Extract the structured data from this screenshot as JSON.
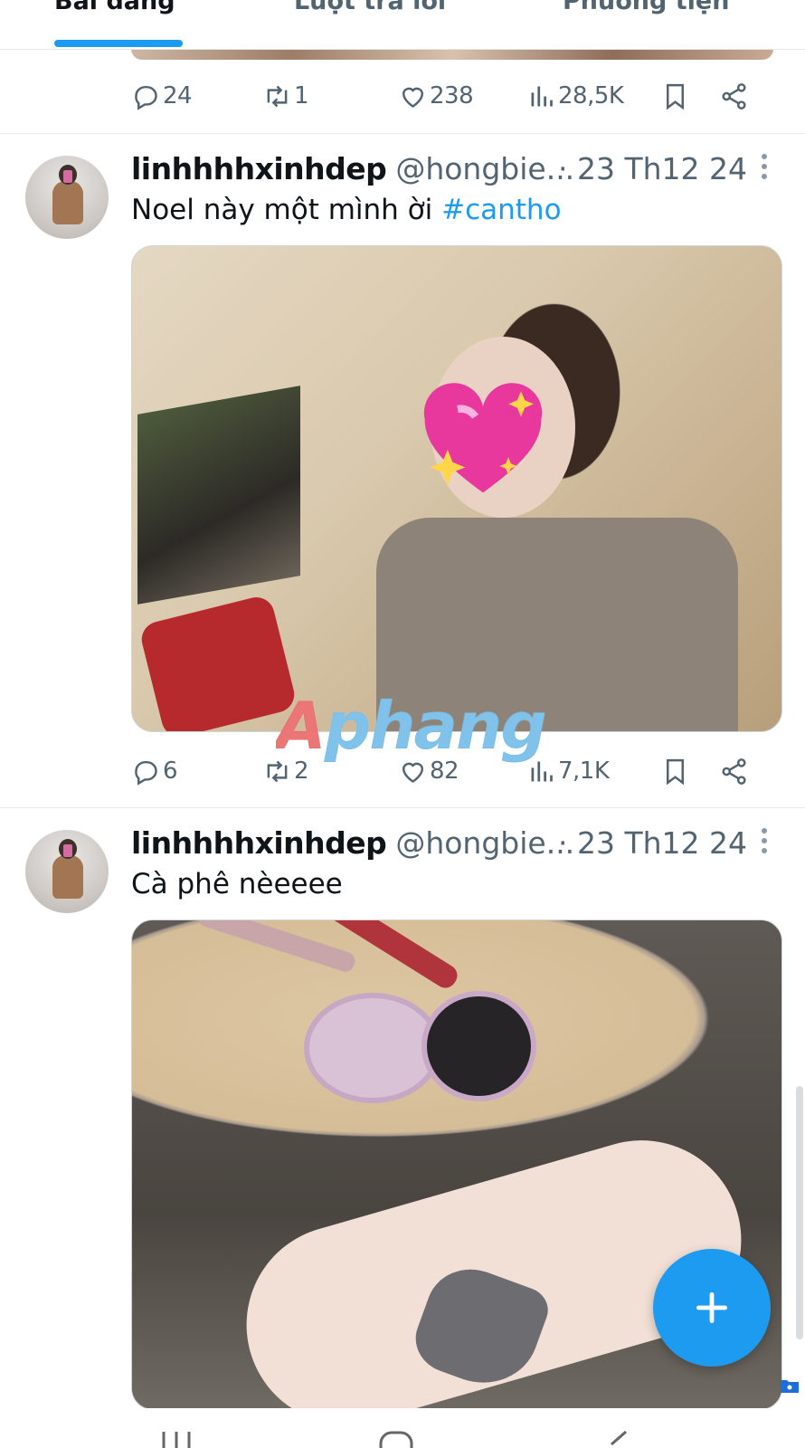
{
  "tabs": [
    {
      "label": "Bài đăng",
      "active": true
    },
    {
      "label": "Lượt trả lời",
      "active": false
    },
    {
      "label": "Phương tiện",
      "active": false
    }
  ],
  "accent_color": "#1d9bf0",
  "top_actions": {
    "replies": "24",
    "reposts": "1",
    "likes": "238",
    "views": "28,5K"
  },
  "tweets": [
    {
      "name": "linhhhhxinhdep",
      "handle": "@hongbie...",
      "date": "· 23 Th12 24",
      "text": "Noel này một mình ời ",
      "hashtag": "#cantho",
      "watermark": "Aphang",
      "actions": {
        "replies": "6",
        "reposts": "2",
        "likes": "82",
        "views": "7,1K"
      }
    },
    {
      "name": "linhhhhxinhdep",
      "handle": "@hongbie...",
      "date": "· 23 Th12 24",
      "text": "Cà phê nèeeee"
    }
  ],
  "icons": {
    "reply": "speech-bubble-icon",
    "repost": "repost-arrows-icon",
    "like": "heart-icon",
    "views": "bar-chart-icon",
    "bookmark": "bookmark-icon",
    "share": "share-icon",
    "more": "more-vertical-icon",
    "compose": "plus-icon"
  }
}
